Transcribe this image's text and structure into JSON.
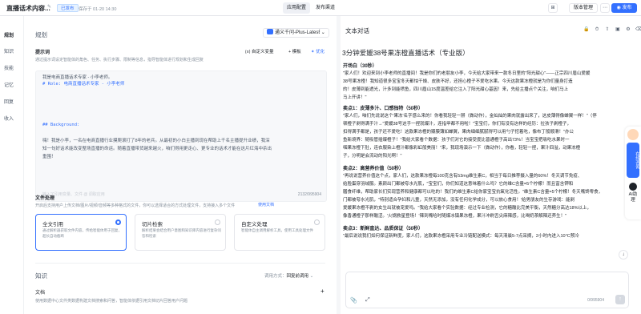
{
  "app": {
    "title": "直播话术内容...",
    "status_badge": "已发布",
    "saved_text": "保存于 01-20 14:30",
    "tabs": [
      "应用配置",
      "发布渠道"
    ],
    "version_label": "版本管理",
    "publish_label": "发布",
    "accent_color": "#3370ff"
  },
  "leftnav": [
    "规划",
    "知识",
    "技能",
    "记忆",
    "回复",
    "收入"
  ],
  "plan": {
    "heading": "规划",
    "model": "通义千问-Plus-Latest",
    "prompt_label": "提示词",
    "prompt_hint": "通过提示词设定智能体的角色、任务、执行步骤、限制等信息，指导智能体进行规划和生成回复",
    "custom_var": "自定义变量",
    "template": "模板",
    "optimize": "优化",
    "prompt_lines": [
      "我是电商直播话术专家 - 小李老师。",
      "# Role: 电商直播话术专家 - 小李老师",
      "",
      "",
      "",
      "",
      "## Background:",
      "",
      "嗨！我是小李，一名在电商直播行业摸爬滚打了8年的老兵。从最初的小白主播到现在帮助上千名主播提升业绩，我深",
      "知一句好话术能改变整场直播的命运。随着直播带货越来越火，咱们得用更走心、更专业的话术才能在这片红海中杀出",
      "重围！"
    ],
    "prompt_footer": "输入\"/\"引用变量、文件  @ 调取应用",
    "prompt_count": "2132/995904",
    "file_label": "文件处理",
    "file_hint": "开启后支持用户上传文档/图片/视频/音频等多种格式的文件，你可以选择适合的方式处理文件，支持接入多个文件",
    "file_link": "使用文档",
    "cards": [
      {
        "title": "全文引用",
        "desc": "通过解析器获取文件内容，传给智能体用于回复，超长自动截断",
        "selected": true
      },
      {
        "title": "切片检索",
        "desc": "解析结果会结合用户意图和知识库内容进行复杂问答和检索",
        "selected": false
      },
      {
        "title": "自定义处理",
        "desc": "智能体自主调用解析工具，使用工具处理文件",
        "selected": false
      }
    ],
    "knowledge_heading": "知识",
    "knowledge_mode": "调用方式：",
    "knowledge_mode_value": "回复前调用",
    "doc_label": "文档",
    "doc_hint": "使用数据中心文件类数据构建文档搜索和问答，智能体依据引用文档切片回答用户问题"
  },
  "chat": {
    "heading": "文本对话",
    "doc_title": "3分钟爱媛38号果冻橙直播话术（专业版）",
    "sections": [
      {
        "h": "开场白（30秒）",
        "lines": [
          "\"家人们！欢迎来到小李老师的直播间！我是你们的老朋友小李，今天给大家带来一款冬日里的\"阳光甜心\"——正宗四川眉山爱媛",
          "38号果冻橙！我知道很多宝宝冬天都怕干燥、皮肤不好，还担心橙子不爱吃水果。今天这款果冻橙就是为你们量身打造",
          "的！皮薄到能透光，汁多到能喷鱼，四川眉山15度温差给它注入了阳光甜心基因！来，先给主播点个关注，咱们马上",
          "马上开讲！\""
        ]
      },
      {
        "h": "卖点1：皮薄多汁、口感独特（50秒）",
        "lines": [
          "\"家人们，咱们先说说这个'果冻'名字感么来的！你看我轻轻一掰（做动作），金灿灿的果肉就露出来了，这皮薄得像蝉翼一样！\"（停",
          "顿橙子剥得满手汁→\"爱媛38号这手一捏就爆汁，连指甲都不用啦！\"宝宝们，你们有没有这样的经历：拉孩子剥橙子，",
          "扣得满手都是，孩子还不爱吃！这款果冻橙的瓣膜薄如蝉翼，果肉细细腻腻得可以用勺子挖着吃，像布丁般顺滑！\"办公",
          "鱼新境界：随吸管插爆橙子！\"我给大家看个数据：孩子们对它的接受度比普通橙子高出73%！当宝宝把吸吃水果时一",
          "咽果冻橙下肚，连衣服染上橙汁都像彩虹般美丽！\"来，我现场演示一下（做动作），你看，轻轻一捏，果汁四溢，动果冻橙",
          "子，分明是会流动的阳光啊！\""
        ]
      },
      {
        "h": "卖点2：高营养价值（50秒）",
        "lines": [
          "\"再说说营养价值这个点，家人们，这款果冻橙每100克含有53mg维生素C，相当于每日推荐摄入量的60%！冬天调节免疫、",
          "给脸蛋穿羽绒服。素颜出门都被夸水光肌，\"宝宝们，你们知道这意味着什么吗？它的维C含量=5个柠檬！而且富含钾和",
          "膳食纤维，帮助家长们实现营养和健康都可以吃的！我们的维生素C给你家宝宝抗氧化活性。\"维生素C含量=5个柠檬！冬天嘴馋零食，",
          "门都被夸水光肌，\"特别适合孕妇和儿童，天然无添加，没有任何化学成分，可以放心食用！'给男朋友的生存游戏：能剥",
          "爱媛果冻橙不剥的女生出就被宠爱吗。\"我给大家看个实验数据：经过专业检测，它的糖酸比完美平衡，天然糖分高达18%以上，",
          "像香通橙子那样酸涩。'火锅救星登场！'辣到嘴哈时随爆冰镇果冻橙，果汁冲刷舌尖麻辣感，比喝奶茶解辣还养生！\""
        ]
      },
      {
        "h": "卖点3：新鲜直达、品质保证（50秒）",
        "lines": [
          "\"最后说说我们如何保证新鲜度，家人们，这款果冻橙采用专业冷链配送模式：每天清晨5-7点采摘，2小时内进入10°C预冷"
        ]
      }
    ],
    "input_count": "0/995904",
    "float_btn": "在线咨询",
    "ai_label": "AI助理"
  }
}
